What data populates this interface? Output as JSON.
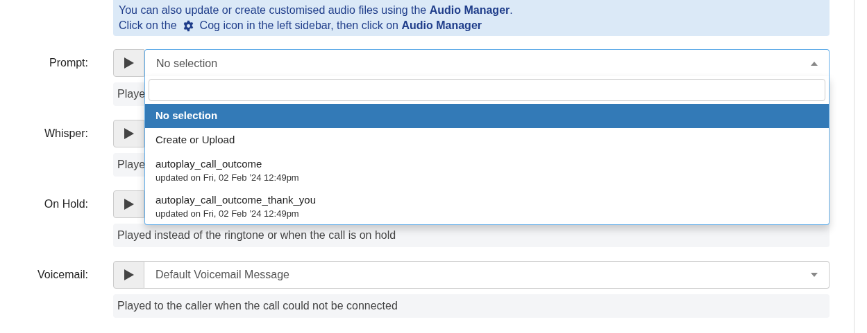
{
  "info": {
    "lines": [
      "You can also update or create customised audio files using the **Audio Manager**."
    ],
    "cog_line": {
      "before": "Click on the",
      "after": "Cog icon in the left sidebar, then click on **Audio Manager**"
    }
  },
  "rows": [
    {
      "label": "Prompt:",
      "value": "No selection",
      "help": "Playe",
      "dropdown": {
        "options": [
          {
            "label": "No selection",
            "selected": true
          },
          {
            "label": "Create or Upload",
            "selected": false
          },
          {
            "label": "autoplay_call_outcome",
            "detail": "updated on Fri, 02 Feb ’24 12:49pm",
            "selected": false
          },
          {
            "label": "autoplay_call_outcome_thank_you",
            "detail": "updated on Fri, 02 Feb ’24 12:49pm",
            "selected": false
          }
        ]
      }
    },
    {
      "label": "Whisper:",
      "help": "Playe"
    },
    {
      "label": "On Hold:",
      "help": "Played instead of the ringtone or when the call is on hold"
    },
    {
      "label": "Voicemail:",
      "value": "Default Voicemail Message",
      "help": "Played to the caller when the call could not be connected"
    }
  ]
}
